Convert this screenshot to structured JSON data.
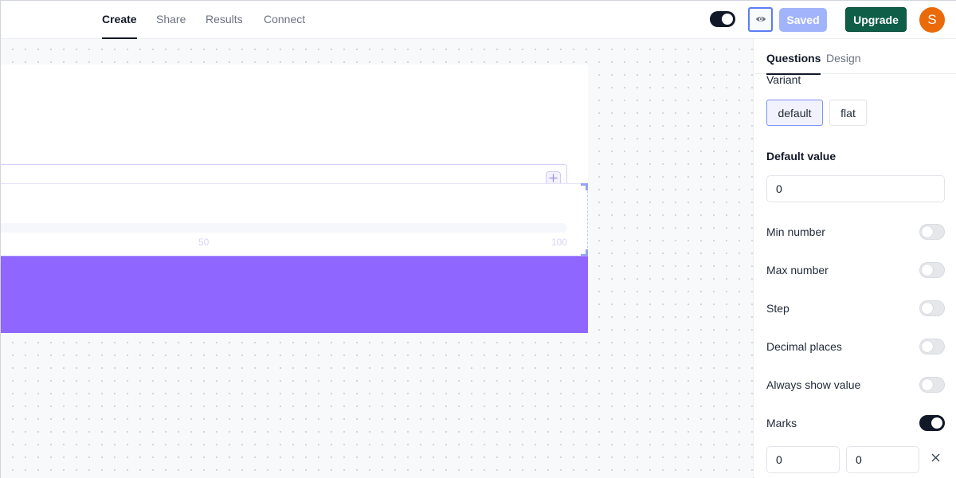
{
  "nav": {
    "tabs": [
      {
        "label": "Create",
        "active": true
      },
      {
        "label": "Share",
        "active": false
      },
      {
        "label": "Results",
        "active": false
      },
      {
        "label": "Connect",
        "active": false
      }
    ]
  },
  "header": {
    "theme_toggle_on": true,
    "preview_icon": "eye-icon",
    "saved_label": "Saved",
    "upgrade_label": "Upgrade",
    "avatar_initial": "S",
    "colors": {
      "saved": "#a1b4fb",
      "upgrade": "#0e5e48",
      "avatar": "#ea6a0a"
    }
  },
  "canvas": {
    "text_field_action_icon": "plus-icon",
    "slider": {
      "marks": [
        "50",
        "100"
      ]
    },
    "accent_block_color": "#8f66ff"
  },
  "panel": {
    "tabs": [
      {
        "label": "Questions",
        "active": true
      },
      {
        "label": "Design",
        "active": false
      }
    ],
    "variant": {
      "label": "Variant",
      "options": [
        "default",
        "flat"
      ],
      "selected": "default"
    },
    "default_value": {
      "label": "Default value",
      "value": "0"
    },
    "toggles": [
      {
        "label": "Min number",
        "on": false
      },
      {
        "label": "Max number",
        "on": false
      },
      {
        "label": "Step",
        "on": false
      },
      {
        "label": "Decimal places",
        "on": false
      },
      {
        "label": "Always show value",
        "on": false
      },
      {
        "label": "Marks",
        "on": true
      }
    ],
    "marks_row": {
      "value_a": "0",
      "value_b": "0",
      "remove_icon": "close-icon"
    }
  }
}
